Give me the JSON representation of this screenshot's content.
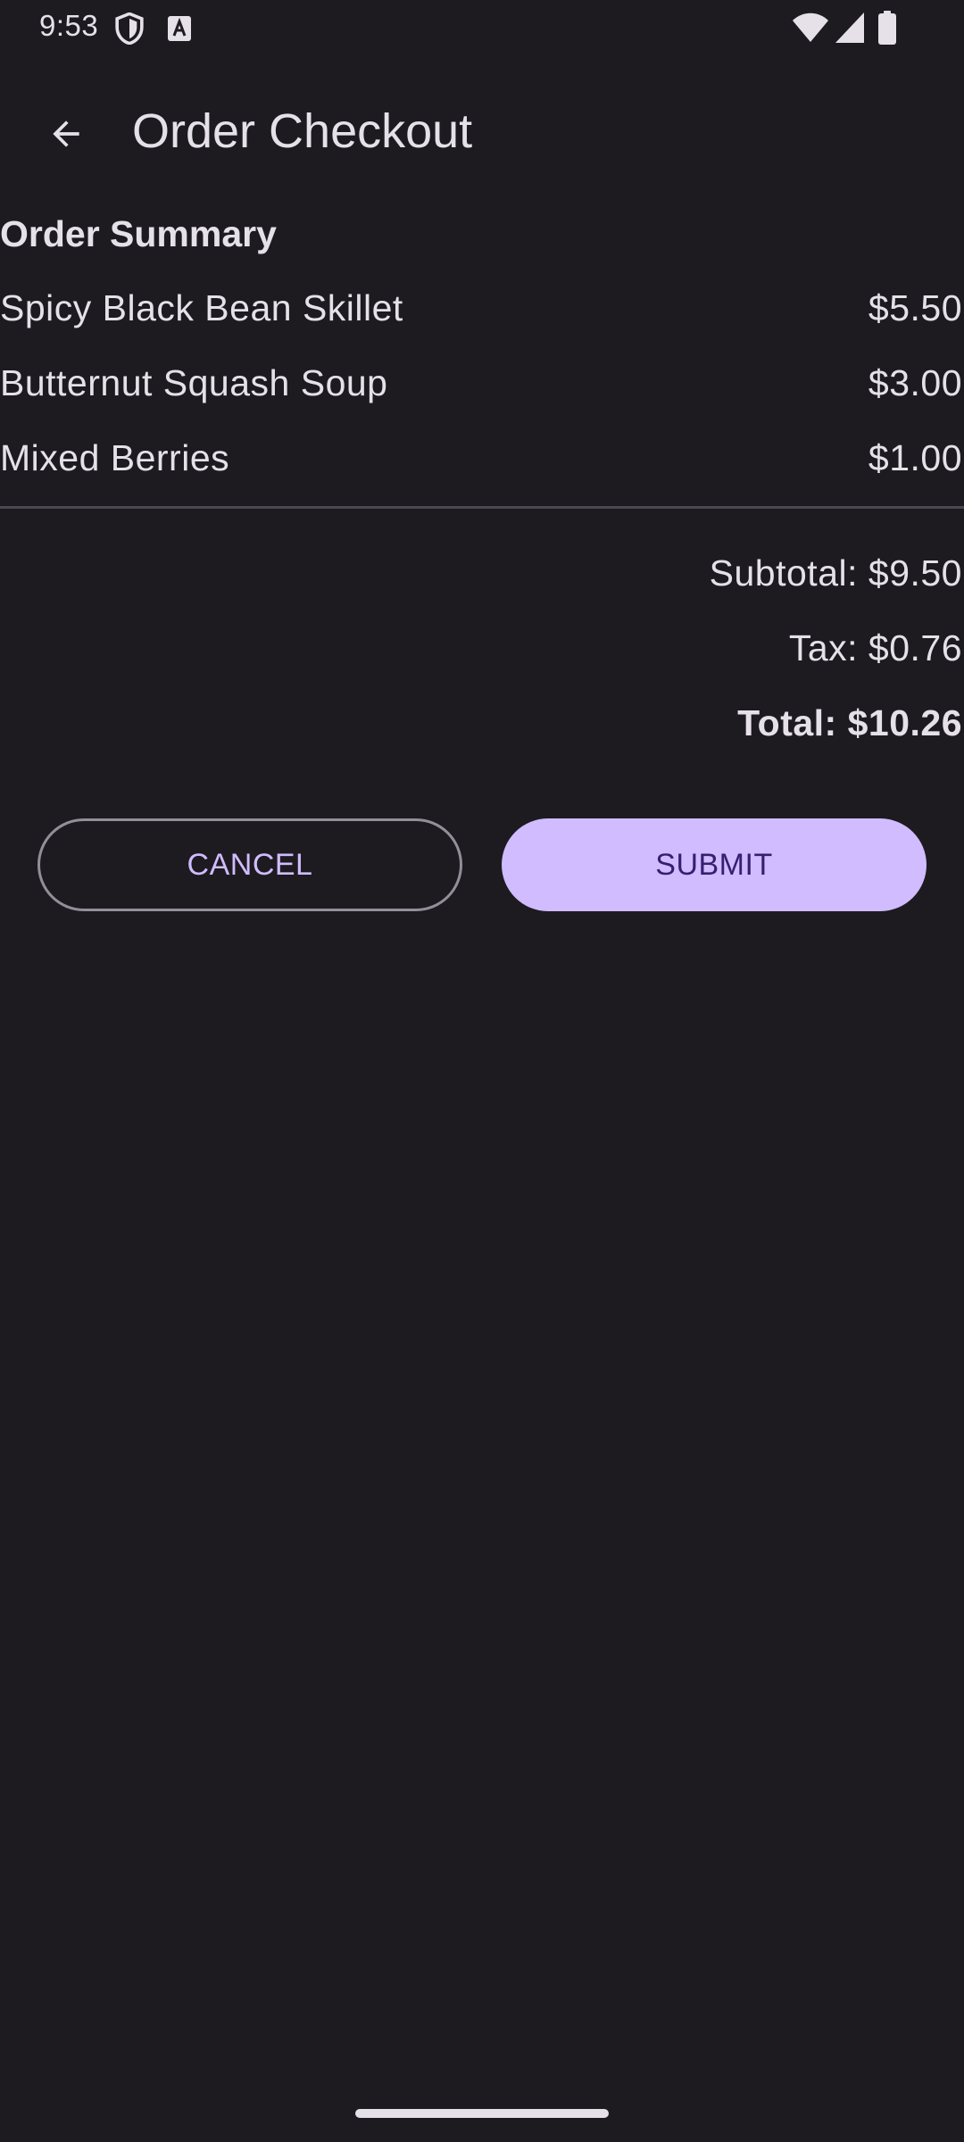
{
  "status_bar": {
    "time": "9:53",
    "icons": [
      "shield-icon",
      "font-a-icon",
      "wifi-icon",
      "signal-icon",
      "battery-icon"
    ]
  },
  "app_bar": {
    "back_icon": "arrow-back-icon",
    "title": "Order Checkout"
  },
  "order_summary": {
    "title": "Order Summary",
    "items": [
      {
        "name": "Spicy Black Bean Skillet",
        "price": "$5.50"
      },
      {
        "name": "Butternut Squash Soup",
        "price": "$3.00"
      },
      {
        "name": "Mixed Berries",
        "price": "$1.00"
      }
    ],
    "subtotal": "Subtotal: $9.50",
    "tax": "Tax: $0.76",
    "total": "Total: $10.26"
  },
  "actions": {
    "cancel_label": "CANCEL",
    "submit_label": "SUBMIT"
  },
  "colors": {
    "background": "#1d1b20",
    "text": "#e6e0e9",
    "primary": "#d0bcff",
    "on_primary": "#381e72",
    "outline": "#938f99"
  }
}
